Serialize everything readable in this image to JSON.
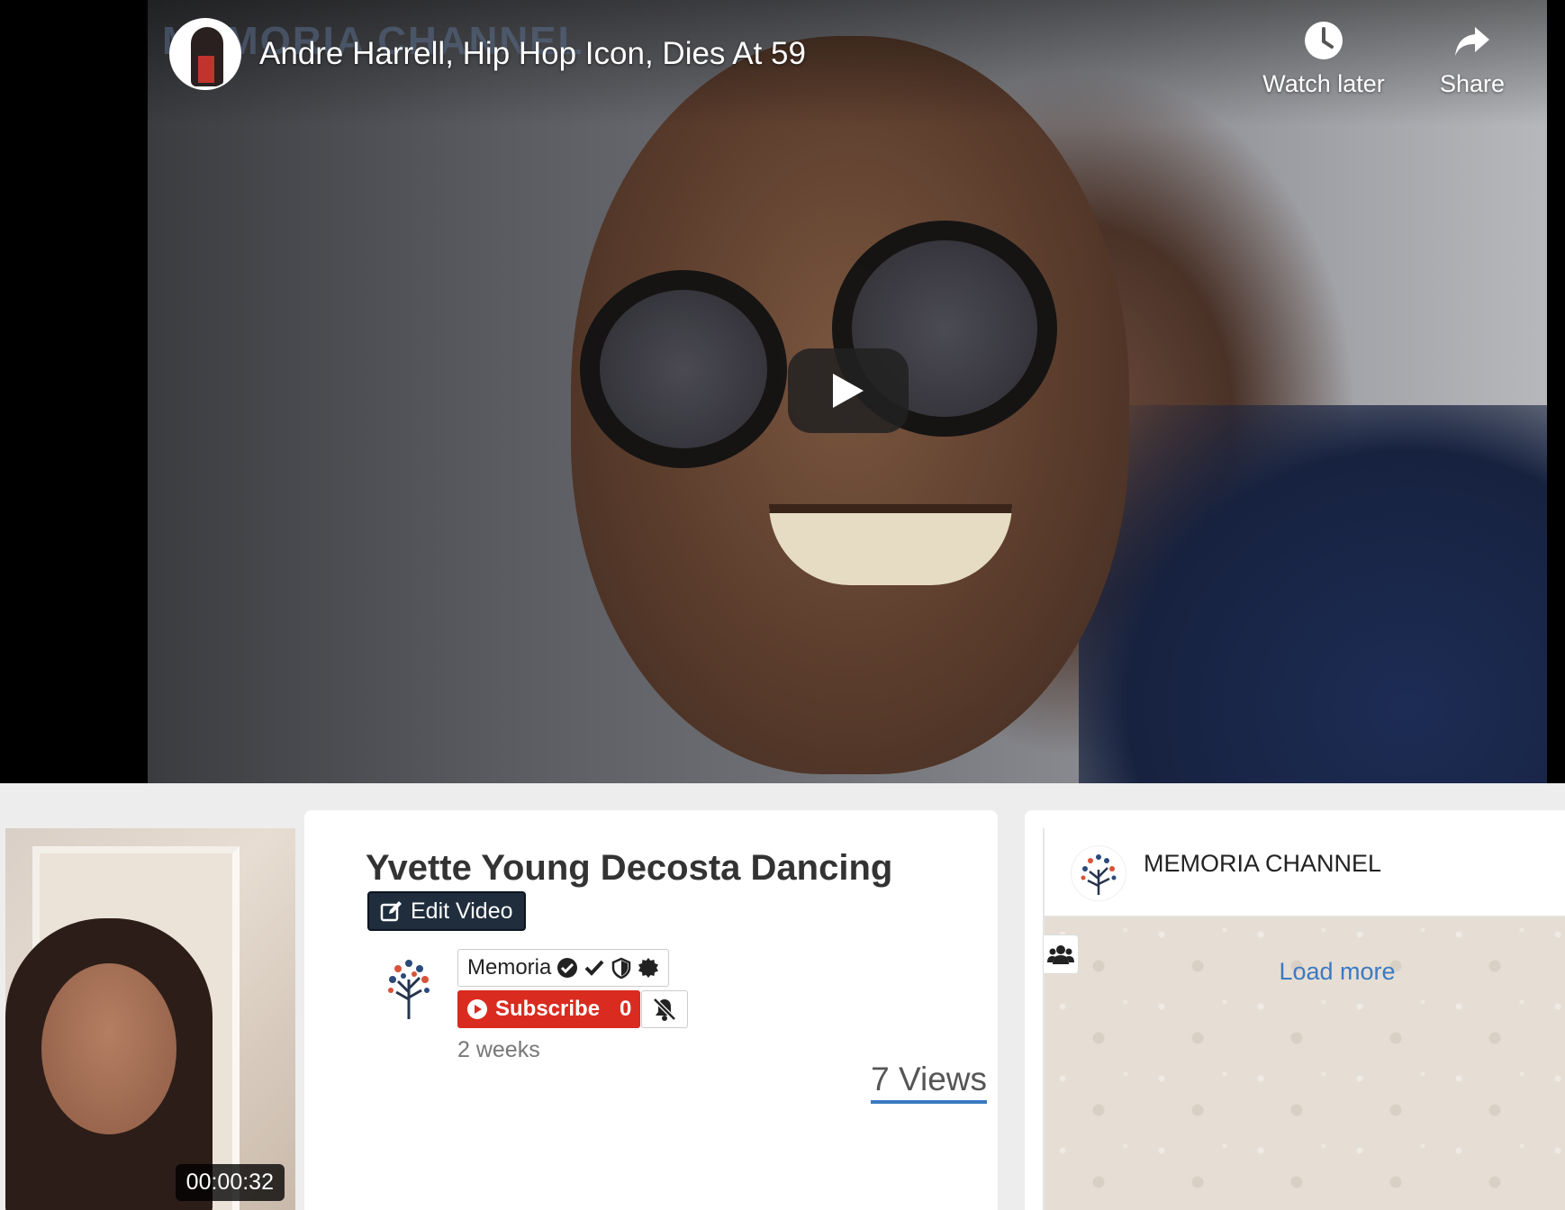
{
  "player": {
    "watermark": "MEMORIA CHANNEL",
    "title": "Andre Harrell, Hip Hop Icon, Dies At 59",
    "watch_later_label": "Watch later",
    "share_label": "Share"
  },
  "thumbnail": {
    "duration": "00:00:32"
  },
  "video_info": {
    "title": "Yvette Young Decosta Dancing",
    "edit_label": "Edit Video",
    "uploader": "Memoria",
    "subscribe_label": "Subscribe",
    "subscriber_count": "0",
    "age": "2 weeks",
    "views": "7 Views"
  },
  "chat": {
    "channel_name": "MEMORIA CHANNEL",
    "load_more_label": "Load more"
  },
  "colors": {
    "subscribe_red": "#d92b1f",
    "edit_navy": "#1f2d3d",
    "link_blue": "#3b79c2",
    "chat_background": "#e6ded4"
  },
  "icons": {
    "watch_later": "clock-icon",
    "share": "share-arrow-icon",
    "play": "play-icon",
    "edit": "edit-icon",
    "verified": [
      "check-circle-icon",
      "check-icon",
      "shield-icon",
      "badge-icon"
    ],
    "subscribe": "play-circle-icon",
    "notifications": "bell-slash-icon",
    "members": "users-icon",
    "logo": "tree-logo-icon"
  }
}
